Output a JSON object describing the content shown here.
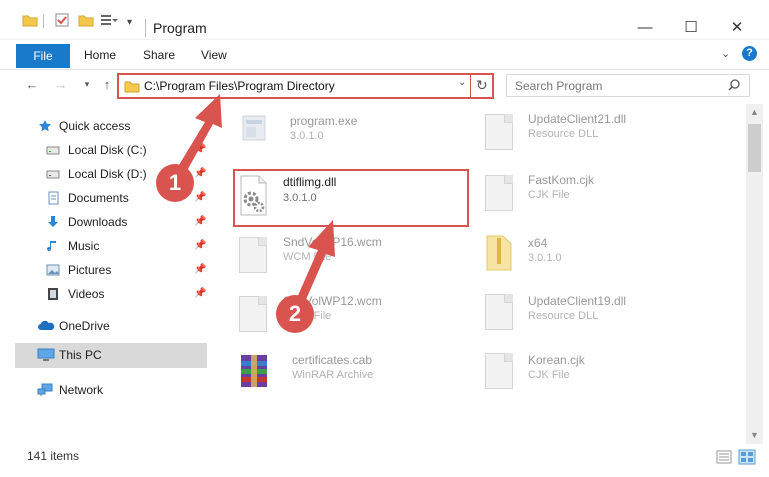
{
  "window": {
    "title": "Program",
    "controls": {
      "minimize": "—",
      "maximize": "☐",
      "close": "✕"
    }
  },
  "ribbon": {
    "tabs": [
      "File",
      "Home",
      "Share",
      "View"
    ]
  },
  "address": {
    "path": "C:\\Program Files\\Program Directory",
    "search_placeholder": "Search Program"
  },
  "sidebar": {
    "items": [
      {
        "label": "Quick access",
        "icon": "star-icon",
        "pinned": false
      },
      {
        "label": "Local Disk (C:)",
        "icon": "drive-icon",
        "pinned": true
      },
      {
        "label": "Local Disk (D:)",
        "icon": "drive-icon",
        "pinned": true
      },
      {
        "label": "Documents",
        "icon": "documents-icon",
        "pinned": true
      },
      {
        "label": "Downloads",
        "icon": "download-icon",
        "pinned": true
      },
      {
        "label": "Music",
        "icon": "music-icon",
        "pinned": true
      },
      {
        "label": "Pictures",
        "icon": "pictures-icon",
        "pinned": true
      },
      {
        "label": "Videos",
        "icon": "videos-icon",
        "pinned": true
      },
      {
        "label": "OneDrive",
        "icon": "cloud-icon",
        "pinned": false
      },
      {
        "label": "This PC",
        "icon": "pc-icon",
        "pinned": false,
        "selected": true
      },
      {
        "label": "Network",
        "icon": "network-icon",
        "pinned": false
      }
    ]
  },
  "files": {
    "left": [
      {
        "name": "program.exe",
        "sub": "3.0.1.0"
      },
      {
        "name": "dtiflimg.dll",
        "sub": "3.0.1.0"
      },
      {
        "name": "SndVolWP16.wcm",
        "sub": "WCM File"
      },
      {
        "name": "SndVolWP12.wcm",
        "sub": "WCM File"
      },
      {
        "name": "certificates.cab",
        "sub": "WinRAR Archive"
      }
    ],
    "right": [
      {
        "name": "UpdateClient21.dll",
        "sub": "Resource DLL"
      },
      {
        "name": "FastKom.cjk",
        "sub": "CJK File"
      },
      {
        "name": "x64",
        "sub": "3.0.1.0"
      },
      {
        "name": "UpdateClient19.dll",
        "sub": "Resource DLL"
      },
      {
        "name": "Korean.cjk",
        "sub": "CJK File"
      }
    ]
  },
  "status": {
    "items_count": "141 items"
  },
  "annotations": {
    "step1": "1",
    "step2": "2"
  },
  "colors": {
    "accent": "#1979ca",
    "annotation": "#d9534f",
    "selected": "#d9d9d9"
  }
}
